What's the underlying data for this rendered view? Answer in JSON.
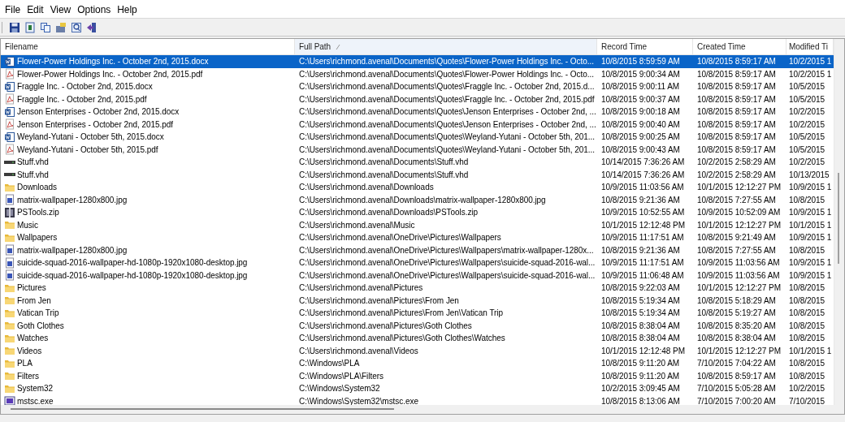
{
  "menu": [
    "File",
    "Edit",
    "View",
    "Options",
    "Help"
  ],
  "toolbar": [
    {
      "kind": "save"
    },
    {
      "kind": "refresh"
    },
    {
      "kind": "copy"
    },
    {
      "kind": "properties"
    },
    {
      "kind": "find"
    },
    {
      "kind": "exit"
    }
  ],
  "table": {
    "columns": [
      {
        "label": "Filename",
        "sorted": false
      },
      {
        "label": "Full Path",
        "sorted": true
      },
      {
        "label": "Record Time",
        "sorted": false
      },
      {
        "label": "Created Time",
        "sorted": false
      },
      {
        "label": "Modified Ti",
        "sorted": false
      }
    ],
    "rows": [
      {
        "kind": "word",
        "selected": true,
        "cells": [
          "Flower-Power Holdings Inc. - October 2nd, 2015.docx",
          "C:\\Users\\richmond.avenal\\Documents\\Quotes\\Flower-Power Holdings Inc. - Octo...",
          "10/8/2015 8:59:59 AM",
          "10/8/2015 8:59:17 AM",
          "10/2/2015 1"
        ]
      },
      {
        "kind": "pdf",
        "selected": false,
        "cells": [
          "Flower-Power Holdings Inc. - October 2nd, 2015.pdf",
          "C:\\Users\\richmond.avenal\\Documents\\Quotes\\Flower-Power Holdings Inc. - Octo...",
          "10/8/2015 9:00:34 AM",
          "10/8/2015 8:59:17 AM",
          "10/2/2015 1"
        ]
      },
      {
        "kind": "word",
        "selected": false,
        "cells": [
          "Fraggle Inc. - October 2nd, 2015.docx",
          "C:\\Users\\richmond.avenal\\Documents\\Quotes\\Fraggle Inc. - October 2nd, 2015.d...",
          "10/8/2015 9:00:11 AM",
          "10/8/2015 8:59:17 AM",
          "10/5/2015"
        ]
      },
      {
        "kind": "pdf",
        "selected": false,
        "cells": [
          "Fraggle Inc. - October 2nd, 2015.pdf",
          "C:\\Users\\richmond.avenal\\Documents\\Quotes\\Fraggle Inc. - October 2nd, 2015.pdf",
          "10/8/2015 9:00:37 AM",
          "10/8/2015 8:59:17 AM",
          "10/5/2015"
        ]
      },
      {
        "kind": "word",
        "selected": false,
        "cells": [
          "Jenson Enterprises - October 2nd, 2015.docx",
          "C:\\Users\\richmond.avenal\\Documents\\Quotes\\Jenson Enterprises - October 2nd, ...",
          "10/8/2015 9:00:18 AM",
          "10/8/2015 8:59:17 AM",
          "10/2/2015"
        ]
      },
      {
        "kind": "pdf",
        "selected": false,
        "cells": [
          "Jenson Enterprises - October 2nd, 2015.pdf",
          "C:\\Users\\richmond.avenal\\Documents\\Quotes\\Jenson Enterprises - October 2nd, ...",
          "10/8/2015 9:00:40 AM",
          "10/8/2015 8:59:17 AM",
          "10/2/2015"
        ]
      },
      {
        "kind": "word",
        "selected": false,
        "cells": [
          "Weyland-Yutani - October 5th, 2015.docx",
          "C:\\Users\\richmond.avenal\\Documents\\Quotes\\Weyland-Yutani - October 5th, 201...",
          "10/8/2015 9:00:25 AM",
          "10/8/2015 8:59:17 AM",
          "10/5/2015"
        ]
      },
      {
        "kind": "pdf",
        "selected": false,
        "cells": [
          "Weyland-Yutani - October 5th, 2015.pdf",
          "C:\\Users\\richmond.avenal\\Documents\\Quotes\\Weyland-Yutani - October 5th, 201...",
          "10/8/2015 9:00:43 AM",
          "10/8/2015 8:59:17 AM",
          "10/5/2015"
        ]
      },
      {
        "kind": "disk",
        "selected": false,
        "cells": [
          "Stuff.vhd",
          "C:\\Users\\richmond.avenal\\Documents\\Stuff.vhd",
          "10/14/2015 7:36:26 AM",
          "10/2/2015 2:58:29 AM",
          "10/2/2015"
        ]
      },
      {
        "kind": "disk",
        "selected": false,
        "cells": [
          "Stuff.vhd",
          "C:\\Users\\richmond.avenal\\Documents\\Stuff.vhd",
          "10/14/2015 7:36:26 AM",
          "10/2/2015 2:58:29 AM",
          "10/13/2015"
        ]
      },
      {
        "kind": "folder",
        "selected": false,
        "cells": [
          "Downloads",
          "C:\\Users\\richmond.avenal\\Downloads",
          "10/9/2015 11:03:56 AM",
          "10/1/2015 12:12:27 PM",
          "10/9/2015 1"
        ]
      },
      {
        "kind": "image",
        "selected": false,
        "cells": [
          "matrix-wallpaper-1280x800.jpg",
          "C:\\Users\\richmond.avenal\\Downloads\\matrix-wallpaper-1280x800.jpg",
          "10/8/2015 9:21:36 AM",
          "10/8/2015 7:27:55 AM",
          "10/8/2015"
        ]
      },
      {
        "kind": "zip",
        "selected": false,
        "cells": [
          "PSTools.zip",
          "C:\\Users\\richmond.avenal\\Downloads\\PSTools.zip",
          "10/9/2015 10:52:55 AM",
          "10/9/2015 10:52:09 AM",
          "10/9/2015 1"
        ]
      },
      {
        "kind": "folder",
        "selected": false,
        "cells": [
          "Music",
          "C:\\Users\\richmond.avenal\\Music",
          "10/1/2015 12:12:48 PM",
          "10/1/2015 12:12:27 PM",
          "10/1/2015 1"
        ]
      },
      {
        "kind": "folder",
        "selected": false,
        "cells": [
          "Wallpapers",
          "C:\\Users\\richmond.avenal\\OneDrive\\Pictures\\Wallpapers",
          "10/9/2015 11:17:51 AM",
          "10/8/2015 9:21:49 AM",
          "10/9/2015 1"
        ]
      },
      {
        "kind": "image",
        "selected": false,
        "cells": [
          "matrix-wallpaper-1280x800.jpg",
          "C:\\Users\\richmond.avenal\\OneDrive\\Pictures\\Wallpapers\\matrix-wallpaper-1280x...",
          "10/8/2015 9:21:36 AM",
          "10/8/2015 7:27:55 AM",
          "10/8/2015"
        ]
      },
      {
        "kind": "image",
        "selected": false,
        "cells": [
          "suicide-squad-2016-wallpaper-hd-1080p-1920x1080-desktop.jpg",
          "C:\\Users\\richmond.avenal\\OneDrive\\Pictures\\Wallpapers\\suicide-squad-2016-wal...",
          "10/9/2015 11:17:51 AM",
          "10/9/2015 11:03:56 AM",
          "10/9/2015 1"
        ]
      },
      {
        "kind": "image",
        "selected": false,
        "cells": [
          "suicide-squad-2016-wallpaper-hd-1080p-1920x1080-desktop.jpg",
          "C:\\Users\\richmond.avenal\\OneDrive\\Pictures\\Wallpapers\\suicide-squad-2016-wal...",
          "10/9/2015 11:06:48 AM",
          "10/9/2015 11:03:56 AM",
          "10/9/2015 1"
        ]
      },
      {
        "kind": "folder",
        "selected": false,
        "cells": [
          "Pictures",
          "C:\\Users\\richmond.avenal\\Pictures",
          "10/8/2015 9:22:03 AM",
          "10/1/2015 12:12:27 PM",
          "10/8/2015"
        ]
      },
      {
        "kind": "folder",
        "selected": false,
        "cells": [
          "From Jen",
          "C:\\Users\\richmond.avenal\\Pictures\\From Jen",
          "10/8/2015 5:19:34 AM",
          "10/8/2015 5:18:29 AM",
          "10/8/2015"
        ]
      },
      {
        "kind": "folder",
        "selected": false,
        "cells": [
          "Vatican Trip",
          "C:\\Users\\richmond.avenal\\Pictures\\From Jen\\Vatican Trip",
          "10/8/2015 5:19:34 AM",
          "10/8/2015 5:19:27 AM",
          "10/8/2015"
        ]
      },
      {
        "kind": "folder",
        "selected": false,
        "cells": [
          "Goth Clothes",
          "C:\\Users\\richmond.avenal\\Pictures\\Goth Clothes",
          "10/8/2015 8:38:04 AM",
          "10/8/2015 8:35:20 AM",
          "10/8/2015"
        ]
      },
      {
        "kind": "folder",
        "selected": false,
        "cells": [
          "Watches",
          "C:\\Users\\richmond.avenal\\Pictures\\Goth Clothes\\Watches",
          "10/8/2015 8:38:04 AM",
          "10/8/2015 8:38:04 AM",
          "10/8/2015"
        ]
      },
      {
        "kind": "folder",
        "selected": false,
        "cells": [
          "Videos",
          "C:\\Users\\richmond.avenal\\Videos",
          "10/1/2015 12:12:48 PM",
          "10/1/2015 12:12:27 PM",
          "10/1/2015 1"
        ]
      },
      {
        "kind": "folder",
        "selected": false,
        "cells": [
          "PLA",
          "C:\\Windows\\PLA",
          "10/8/2015 9:11:20 AM",
          "7/10/2015 7:04:22 AM",
          "10/8/2015"
        ]
      },
      {
        "kind": "folder",
        "selected": false,
        "cells": [
          "Filters",
          "C:\\Windows\\PLA\\Filters",
          "10/8/2015 9:11:20 AM",
          "10/8/2015 8:59:17 AM",
          "10/8/2015"
        ]
      },
      {
        "kind": "folder",
        "selected": false,
        "cells": [
          "System32",
          "C:\\Windows\\System32",
          "10/2/2015 3:09:45 AM",
          "7/10/2015 5:05:28 AM",
          "10/2/2015"
        ]
      },
      {
        "kind": "exe",
        "selected": false,
        "cells": [
          "mstsc.exe",
          "C:\\Windows\\System32\\mstsc.exe",
          "10/8/2015 8:13:06 AM",
          "7/10/2015 7:00:20 AM",
          "7/10/2015"
        ]
      }
    ]
  }
}
